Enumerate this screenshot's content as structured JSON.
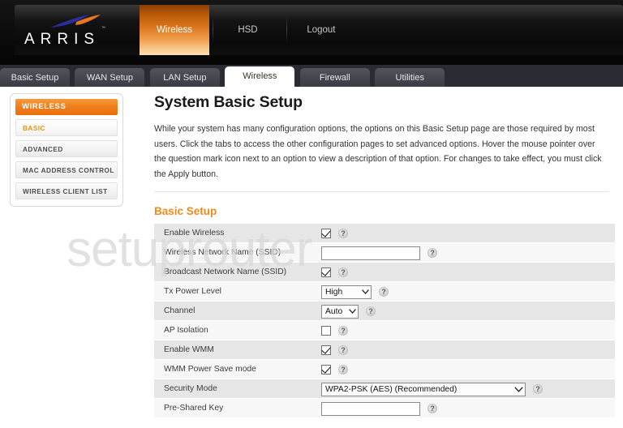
{
  "brand": {
    "name": "ARRIS",
    "trademark": "™",
    "logo_swoosh_blue": "#2b2f9e",
    "logo_swoosh_orange": "#e87722"
  },
  "topnav": {
    "items": [
      {
        "label": "Wireless",
        "active": true
      },
      {
        "label": "HSD",
        "active": false
      },
      {
        "label": "Logout",
        "active": false
      }
    ],
    "active_color": "#e07a1a"
  },
  "tabs": [
    {
      "label": "Basic Setup",
      "active": false
    },
    {
      "label": "WAN Setup",
      "active": false
    },
    {
      "label": "LAN Setup",
      "active": false
    },
    {
      "label": "Wireless",
      "active": true
    },
    {
      "label": "Firewall",
      "active": false
    },
    {
      "label": "Utilities",
      "active": false
    }
  ],
  "sidebar": {
    "header": "WIRELESS",
    "header_color": "#ef8b1e",
    "items": [
      {
        "label": "BASIC",
        "active": true
      },
      {
        "label": "ADVANCED",
        "active": false
      },
      {
        "label": "MAC ADDRESS CONTROL",
        "active": false
      },
      {
        "label": "WIRELESS CLIENT LIST",
        "active": false
      }
    ]
  },
  "main": {
    "title": "System Basic Setup",
    "description": "While your system has many configuration options, the options on this Basic Setup page are those required by most users. Click the tabs to access the other configuration pages to set advanced options. Hover the mouse pointer over the question mark icon next to an option to view a description of that option. For changes to take effect, you must click the Apply button.",
    "section_title": "Basic Setup",
    "section_title_color": "#ef8b1e",
    "help_icon": "?",
    "rows": [
      {
        "label": "Enable Wireless",
        "type": "checkbox",
        "checked": true,
        "help": "?"
      },
      {
        "label": "Wireless Network Name (SSID)",
        "type": "text",
        "value": "",
        "help": "?"
      },
      {
        "label": "Broadcast Network Name (SSID)",
        "type": "checkbox",
        "checked": true,
        "help": "?"
      },
      {
        "label": "Tx Power Level",
        "type": "select",
        "value": "High",
        "help": "?"
      },
      {
        "label": "Channel",
        "type": "select",
        "value": "Auto",
        "help": "?"
      },
      {
        "label": "AP Isolation",
        "type": "checkbox",
        "checked": false,
        "help": "?"
      },
      {
        "label": "Enable WMM",
        "type": "checkbox",
        "checked": true,
        "help": "?"
      },
      {
        "label": "WMM Power Save mode",
        "type": "checkbox",
        "checked": true,
        "help": "?"
      },
      {
        "label": "Security Mode",
        "type": "select",
        "value": "WPA2-PSK (AES) (Recommended)",
        "help": "?"
      },
      {
        "label": "Pre-Shared Key",
        "type": "text",
        "value": "",
        "help": "?"
      }
    ]
  },
  "watermark": {
    "text": "setuprouter"
  }
}
